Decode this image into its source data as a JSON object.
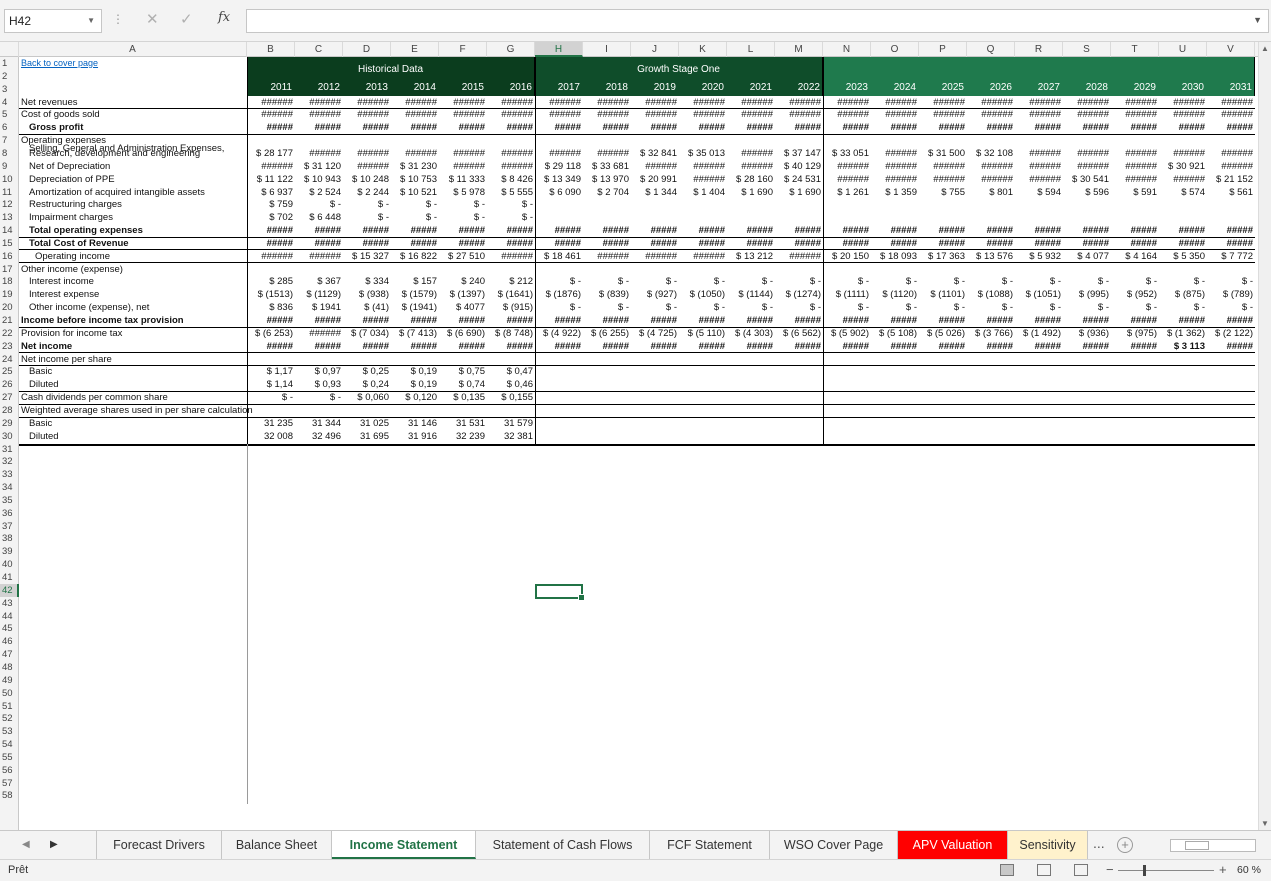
{
  "formula_bar": {
    "cell_ref": "H42",
    "formula": "",
    "cancel": "✕",
    "enter": "✓",
    "fx": "fx"
  },
  "columns": [
    "A",
    "B",
    "C",
    "D",
    "E",
    "F",
    "G",
    "H",
    "I",
    "J",
    "K",
    "L",
    "M",
    "N",
    "O",
    "P",
    "Q",
    "R",
    "S",
    "T",
    "U",
    "V"
  ],
  "selected_column": "H",
  "selected_row": 42,
  "row_count": 58,
  "bands": [
    {
      "title": "Historical Data",
      "color": "#0b3d1e"
    },
    {
      "title": "Growth Stage One",
      "color": "#0f4d2a"
    },
    {
      "title": "",
      "color": "#1f7a4d"
    }
  ],
  "years": [
    "2011",
    "2012",
    "2013",
    "2014",
    "2015",
    "2016",
    "2017",
    "2018",
    "2019",
    "2020",
    "2021",
    "2022",
    "2023",
    "2024",
    "2025",
    "2026",
    "2027",
    "2028",
    "2029",
    "2030",
    "2031"
  ],
  "labels": [
    {
      "row": 1,
      "text": "Back to cover page",
      "style": "link"
    },
    {
      "row": 4,
      "text": "Net revenues"
    },
    {
      "row": 5,
      "text": "Cost of goods sold"
    },
    {
      "row": 6,
      "text": "Gross profit",
      "style": "bold-ind"
    },
    {
      "row": 7,
      "text": "Operating expenses"
    },
    {
      "row": 8,
      "text": "Research, development and engineering",
      "style": "ind"
    },
    {
      "row": 8.6,
      "text": "Selling, General and Administration Expenses,",
      "style": "ind"
    },
    {
      "row": 9,
      "text": "Net of Depreciation",
      "style": "ind"
    },
    {
      "row": 10,
      "text": "Depreciation of PPE",
      "style": "ind"
    },
    {
      "row": 11,
      "text": "Amortization of acquired intangible assets",
      "style": "ind"
    },
    {
      "row": 12,
      "text": "Restructuring charges",
      "style": "ind"
    },
    {
      "row": 13,
      "text": "Impairment charges",
      "style": "ind"
    },
    {
      "row": 14,
      "text": "Total operating expenses",
      "style": "bold-ind"
    },
    {
      "row": 15,
      "text": "Total Cost of Revenue",
      "style": "bold-ind"
    },
    {
      "row": 16,
      "text": "Operating income",
      "style": "ind2"
    },
    {
      "row": 17,
      "text": "Other income (expense)"
    },
    {
      "row": 18,
      "text": "Interest income",
      "style": "ind"
    },
    {
      "row": 19,
      "text": "Interest expense",
      "style": "ind"
    },
    {
      "row": 20,
      "text": "Other income (expense), net",
      "style": "ind"
    },
    {
      "row": 21,
      "text": "Income before income tax provision",
      "style": "bold"
    },
    {
      "row": 22,
      "text": "Provision for income tax"
    },
    {
      "row": 23,
      "text": "Net income",
      "style": "bold"
    },
    {
      "row": 24,
      "text": "Net income per share"
    },
    {
      "row": 25,
      "text": "Basic",
      "style": "ind"
    },
    {
      "row": 26,
      "text": "Diluted",
      "style": "ind"
    },
    {
      "row": 27,
      "text": "Cash dividends per common share"
    },
    {
      "row": 28,
      "text": "Weighted average shares used in per share calculation"
    },
    {
      "row": 29,
      "text": "Basic",
      "style": "ind"
    },
    {
      "row": 30,
      "text": "Diluted",
      "style": "ind"
    }
  ],
  "values": {
    "4": [
      "######",
      "######",
      "######",
      "######",
      "######",
      "######",
      "######",
      "######",
      "######",
      "######",
      "######",
      "######",
      "######",
      "######",
      "######",
      "######",
      "######",
      "######",
      "######",
      "######",
      "######"
    ],
    "5": [
      "######",
      "######",
      "######",
      "######",
      "######",
      "######",
      "######",
      "######",
      "######",
      "######",
      "######",
      "######",
      "######",
      "######",
      "######",
      "######",
      "######",
      "######",
      "######",
      "######",
      "######"
    ],
    "6": [
      "#####",
      "#####",
      "#####",
      "#####",
      "#####",
      "#####",
      "#####",
      "#####",
      "#####",
      "#####",
      "#####",
      "#####",
      "#####",
      "#####",
      "#####",
      "#####",
      "#####",
      "#####",
      "#####",
      "#####",
      "#####"
    ],
    "8": [
      "$ 28 177",
      "######",
      "######",
      "######",
      "######",
      "######",
      "######",
      "######",
      "$ 32 841",
      "$ 35 013",
      "######",
      "$ 37 147",
      "$ 33 051",
      "######",
      "$ 31 500",
      "$ 32 108",
      "######",
      "######",
      "######",
      "######",
      "######"
    ],
    "9": [
      "######",
      "$ 31 120",
      "######",
      "$ 31 230",
      "######",
      "######",
      "$ 29 118",
      "$ 33 681",
      "######",
      "######",
      "######",
      "$ 40 129",
      "######",
      "######",
      "######",
      "######",
      "######",
      "######",
      "######",
      "$ 30 921",
      "######"
    ],
    "10": [
      "$ 11 122",
      "$ 10 943",
      "$ 10 248",
      "$ 10 753",
      "$ 11 333",
      "$ 8 426",
      "$ 13 349",
      "$ 13 970",
      "$ 20 991",
      "######",
      "$ 28 160",
      "$ 24 531",
      "######",
      "######",
      "######",
      "######",
      "######",
      "$ 30 541",
      "######",
      "######",
      "$ 21 152"
    ],
    "11": [
      "$ 6 937",
      "$ 2 524",
      "$ 2 244",
      "$ 10 521",
      "$ 5 978",
      "$ 5 555",
      "$ 6 090",
      "$ 2 704",
      "$ 1 344",
      "$ 1 404",
      "$ 1 690",
      "$ 1 690",
      "$ 1 261",
      "$ 1 359",
      "$ 755",
      "$ 801",
      "$ 594",
      "$ 596",
      "$ 591",
      "$ 574",
      "$ 561"
    ],
    "12": [
      "$ 759",
      "$ -",
      "$ -",
      "$ -",
      "$ -",
      "$ -",
      "",
      "",
      "",
      "",
      "",
      "",
      "",
      "",
      "",
      "",
      "",
      "",
      "",
      "",
      ""
    ],
    "13": [
      "$ 702",
      "$ 6 448",
      "$ -",
      "$ -",
      "$ -",
      "$ -",
      "",
      "",
      "",
      "",
      "",
      "",
      "",
      "",
      "",
      "",
      "",
      "",
      "",
      "",
      ""
    ],
    "14": [
      "#####",
      "#####",
      "#####",
      "#####",
      "#####",
      "#####",
      "#####",
      "#####",
      "#####",
      "#####",
      "#####",
      "#####",
      "#####",
      "#####",
      "#####",
      "#####",
      "#####",
      "#####",
      "#####",
      "#####",
      "#####"
    ],
    "15": [
      "#####",
      "#####",
      "#####",
      "#####",
      "#####",
      "#####",
      "#####",
      "#####",
      "#####",
      "#####",
      "#####",
      "#####",
      "#####",
      "#####",
      "#####",
      "#####",
      "#####",
      "#####",
      "#####",
      "#####",
      "#####"
    ],
    "16": [
      "######",
      "######",
      "$ 15 327",
      "$ 16 822",
      "$ 27 510",
      "######",
      "$ 18 461",
      "######",
      "######",
      "######",
      "$ 13 212",
      "######",
      "$ 20 150",
      "$ 18 093",
      "$ 17 363",
      "$ 13 576",
      "$ 5 932",
      "$ 4 077",
      "$ 4 164",
      "$ 5 350",
      "$ 7 772"
    ],
    "18": [
      "$ 285",
      "$ 367",
      "$ 334",
      "$ 157",
      "$ 240",
      "$ 212",
      "$ -",
      "$ -",
      "$ -",
      "$ -",
      "$ -",
      "$ -",
      "$ -",
      "$ -",
      "$ -",
      "$ -",
      "$ -",
      "$ -",
      "$ -",
      "$ -",
      "$ -"
    ],
    "19": [
      "$ (1513)",
      "$ (1129)",
      "$ (938)",
      "$ (1579)",
      "$ (1397)",
      "$ (1641)",
      "$ (1876)",
      "$ (839)",
      "$ (927)",
      "$ (1050)",
      "$ (1144)",
      "$ (1274)",
      "$ (1111)",
      "$ (1120)",
      "$ (1101)",
      "$ (1088)",
      "$ (1051)",
      "$ (995)",
      "$ (952)",
      "$ (875)",
      "$ (789)"
    ],
    "20": [
      "$ 836",
      "$ 1941",
      "$ (41)",
      "$ (1941)",
      "$ 4077",
      "$ (915)",
      "$ -",
      "$ -",
      "$ -",
      "$ -",
      "$ -",
      "$ -",
      "$ -",
      "$ -",
      "$ -",
      "$ -",
      "$ -",
      "$ -",
      "$ -",
      "$ -",
      "$ -"
    ],
    "21": [
      "#####",
      "#####",
      "#####",
      "#####",
      "#####",
      "#####",
      "#####",
      "#####",
      "#####",
      "#####",
      "#####",
      "#####",
      "#####",
      "#####",
      "#####",
      "#####",
      "#####",
      "#####",
      "#####",
      "#####",
      "#####"
    ],
    "22": [
      "$ (6 253)",
      "######",
      "$ (7 034)",
      "$ (7 413)",
      "$ (6 690)",
      "$ (8 748)",
      "$ (4 922)",
      "$ (6 255)",
      "$ (4 725)",
      "$ (5 110)",
      "$ (4 303)",
      "$ (6 562)",
      "$ (5 902)",
      "$ (5 108)",
      "$ (5 026)",
      "$ (3 766)",
      "$ (1 492)",
      "$ (936)",
      "$ (975)",
      "$ (1 362)",
      "$ (2 122)"
    ],
    "23": [
      "#####",
      "#####",
      "#####",
      "#####",
      "#####",
      "#####",
      "#####",
      "#####",
      "#####",
      "#####",
      "#####",
      "#####",
      "#####",
      "#####",
      "#####",
      "#####",
      "#####",
      "#####",
      "#####",
      "$ 3 113",
      "#####"
    ],
    "25": [
      "$ 1,17",
      "$ 0,97",
      "$ 0,25",
      "$ 0,19",
      "$ 0,75",
      "$ 0,47",
      "",
      "",
      "",
      "",
      "",
      "",
      "",
      "",
      "",
      "",
      "",
      "",
      "",
      "",
      ""
    ],
    "26": [
      "$ 1,14",
      "$ 0,93",
      "$ 0,24",
      "$ 0,19",
      "$ 0,74",
      "$ 0,46",
      "",
      "",
      "",
      "",
      "",
      "",
      "",
      "",
      "",
      "",
      "",
      "",
      "",
      "",
      ""
    ],
    "27": [
      "$ -",
      "$ -",
      "$ 0,060",
      "$ 0,120",
      "$ 0,135",
      "$ 0,155",
      "",
      "",
      "",
      "",
      "",
      "",
      "",
      "",
      "",
      "",
      "",
      "",
      "",
      "",
      ""
    ],
    "29": [
      "31 235",
      "31 344",
      "31 025",
      "31 146",
      "31 531",
      "31 579",
      "",
      "",
      "",
      "",
      "",
      "",
      "",
      "",
      "",
      "",
      "",
      "",
      "",
      "",
      ""
    ],
    "30": [
      "32 008",
      "32 496",
      "31 695",
      "31 916",
      "32 239",
      "32 381",
      "",
      "",
      "",
      "",
      "",
      "",
      "",
      "",
      "",
      "",
      "",
      "",
      "",
      "",
      ""
    ]
  },
  "bold_rows": [
    6,
    14,
    15,
    21,
    23
  ],
  "tabs": [
    {
      "label": "Forecast Drivers",
      "state": "normal"
    },
    {
      "label": "Balance Sheet",
      "state": "normal"
    },
    {
      "label": "Income Statement",
      "state": "active"
    },
    {
      "label": "Statement of Cash Flows",
      "state": "normal"
    },
    {
      "label": "FCF Statement",
      "state": "normal"
    },
    {
      "label": "WSO Cover Page",
      "state": "normal"
    },
    {
      "label": "APV Valuation",
      "state": "red"
    },
    {
      "label": "Sensitivity",
      "state": "yellow"
    }
  ],
  "more_tabs": "...",
  "status": "Prêt",
  "zoom": "60 %",
  "colors": {
    "accent": "#217346",
    "band_dark": "#0b3d1e",
    "band_mid": "#0f4d2a",
    "band_light": "#1f7a4d",
    "red_tab": "#ff0000",
    "yellow_tab": "#fff2cc"
  }
}
